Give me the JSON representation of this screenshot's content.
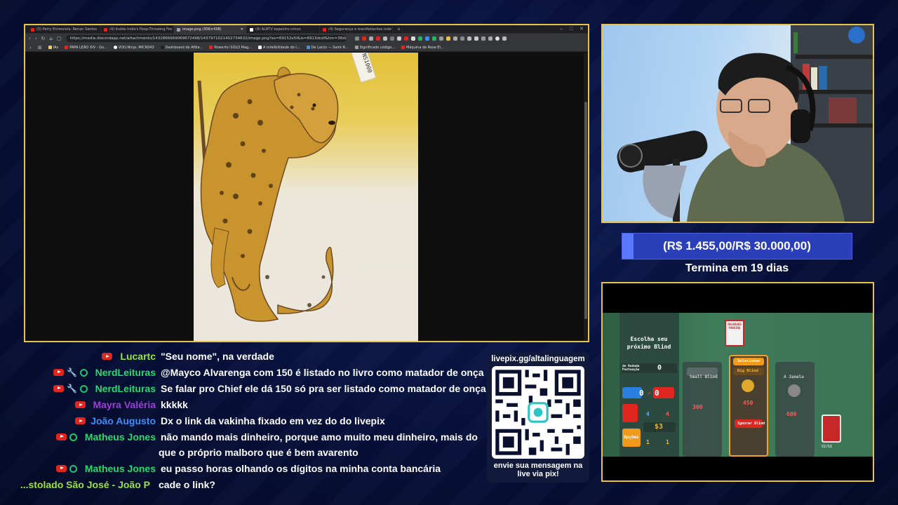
{
  "browser": {
    "tabs": [
      {
        "label": "(5) Petry Entrevista: Renan Santos",
        "color": "#e0261f"
      },
      {
        "label": "(4) Inside India's Poop-Throwing Fes",
        "color": "#e0261f"
      },
      {
        "label": "image.png (306×438)",
        "color": "#9aa0a6"
      },
      {
        "label": "(4) ALBTV expectro-circos",
        "color": "#ffffff"
      },
      {
        "label": "(4) Segurança e manifestantes inde",
        "color": "#e0261f"
      }
    ],
    "url": "https://media.discordapp.net/attachments/1432866669069672498/1437971021402734632/image.png?ex=69152e5f&is=6913dcdf&hm=36ddf389c1...",
    "bookmarks": [
      {
        "label": "IAs",
        "color": "#ffd04a"
      },
      {
        "label": "PAPA LEÃO XIV - Go...",
        "color": "#e0261f"
      },
      {
        "label": "VOO.Ninja: MICR043",
        "color": "#ffffff"
      },
      {
        "label": "Dashboard de Afilia...",
        "color": "#222222"
      },
      {
        "label": "Powerful SOLO Mag...",
        "color": "#e0261f"
      },
      {
        "label": "A infalibilidade do l...",
        "color": "#ffffff"
      },
      {
        "label": "De Laicis — Saint R...",
        "color": "#3e8ef7"
      },
      {
        "label": "Significado código...",
        "color": "#9aa0a6"
      },
      {
        "label": "Máquina de Rose El...",
        "color": "#e0261f"
      }
    ],
    "image_tag": "NS1000"
  },
  "goal": {
    "text": "(R$ 1.455,00/R$ 30.000,00)",
    "progress": 0.0485,
    "ends": "Termina em 19 dias"
  },
  "game": {
    "choose_title": "Escolha seu próximo Blind",
    "round_label": "de Rodada Pontuação",
    "score": "0",
    "hands": "0",
    "discards": "0",
    "money": "$3",
    "ante": "1",
    "round": "1",
    "small_blind": "Small Blind",
    "big_blind": "Big Blind",
    "select": "Selecionar",
    "skip": "Ignorar Blind",
    "boss": "A Janela",
    "hands_n": "4",
    "discards_n": "4",
    "small_score": "300",
    "big_score": "450",
    "boss_score": "600",
    "options": "Opções",
    "deck_count": "52/52",
    "reserved": "RESERVED PARKING"
  },
  "chat": [
    {
      "badges": [
        "yt"
      ],
      "user": "Lucartc",
      "user_color": "#9be33a",
      "text": "\"Seu nome\", na verdade"
    },
    {
      "badges": [
        "yt",
        "wrench",
        "coin"
      ],
      "user": "NerdLeituras",
      "user_color": "#28d96e",
      "text": "@Mayco Alvarenga com 150 é listado no livro como matador de onça"
    },
    {
      "badges": [
        "yt",
        "wrench",
        "coin"
      ],
      "user": "NerdLeituras",
      "user_color": "#28d96e",
      "text": "Se falar pro Chief ele dá 150 só pra ser listado como matador de onça"
    },
    {
      "badges": [
        "yt"
      ],
      "user": "Mayra Valéria",
      "user_color": "#9b3fd6",
      "text": "kkkkk"
    },
    {
      "badges": [
        "yt"
      ],
      "user": "João Augusto",
      "user_color": "#3e8ef7",
      "text": "Dx o link da vakinha fixado em vez do do livepix"
    },
    {
      "badges": [
        "yt",
        "coin"
      ],
      "user": "Matheus Jones",
      "user_color": "#28d96e",
      "text": "não mando mais dinheiro, porque amo muito meu dinheiro, mais do",
      "text2": "que o próprio malboro que é bem avarento"
    },
    {
      "badges": [
        "yt",
        "coin"
      ],
      "user": "Matheus Jones",
      "user_color": "#28d96e",
      "text": "eu passo horas olhando os dígitos na minha conta bancária"
    },
    {
      "badges": [],
      "user": "stolado São José - João P...",
      "user_color": "#9be33a",
      "text": "cade o link?"
    }
  ],
  "qr": {
    "url": "livepix.gg/altalinguagem",
    "cta": "envie sua mensagem na live via pix!"
  }
}
